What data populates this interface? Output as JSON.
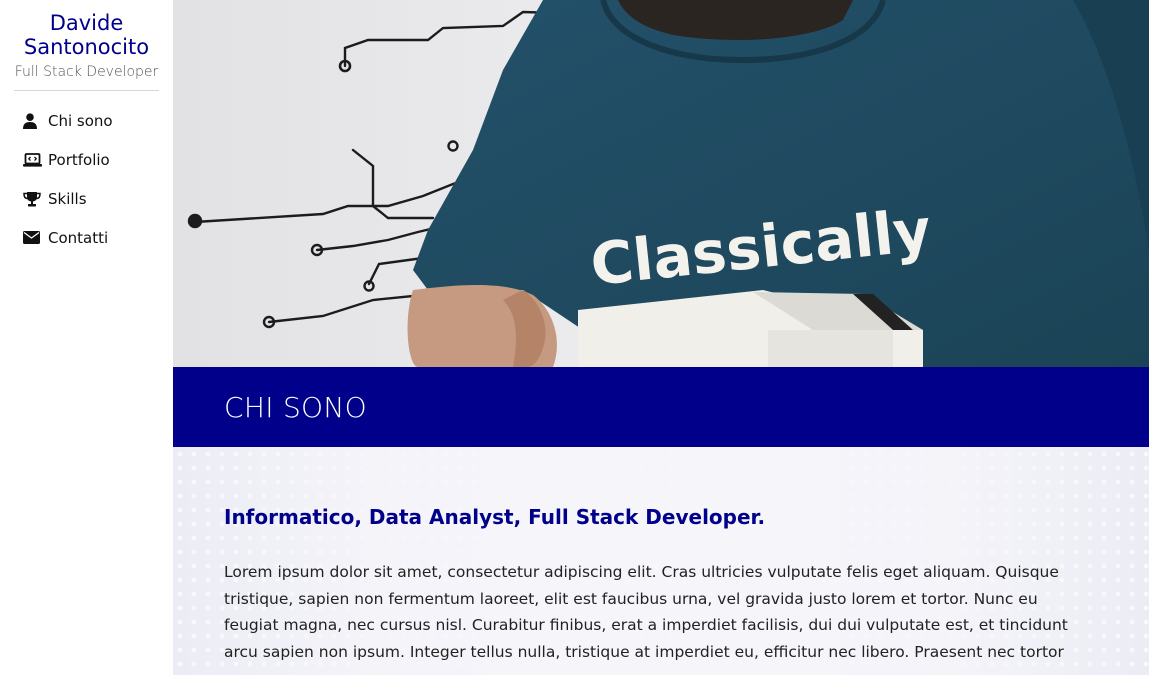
{
  "sidebar": {
    "brand_name": "Davide Santonocito",
    "brand_role": "Full Stack Developer",
    "nav": [
      {
        "label": "Chi sono",
        "icon": "user-icon"
      },
      {
        "label": "Portfolio",
        "icon": "laptop-code-icon"
      },
      {
        "label": "Skills",
        "icon": "trophy-icon"
      },
      {
        "label": "Contatti",
        "icon": "envelope-icon"
      }
    ]
  },
  "hero": {
    "shirt_text": "Classically"
  },
  "section": {
    "title": "CHI SONO",
    "subtitle": "Informatico, Data Analyst, Full Stack Developer.",
    "body": "Lorem ipsum dolor sit amet, consectetur adipiscing elit. Cras ultricies vulputate felis eget aliquam. Quisque tristique, sapien non fermentum laoreet, elit est faucibus urna, vel gravida justo lorem et tortor. Nunc eu feugiat magna, nec cursus nisl. Curabitur finibus, erat a imperdiet facilisis, dui dui vulputate est, et tincidunt arcu sapien non ipsum. Integer tellus nulla, tristique at imperdiet eu, efficitur nec libero. Praesent nec tortor"
  },
  "colors": {
    "accent": "#00008b",
    "shirt": "#1f4a5e",
    "wall": "#e9e9eb"
  }
}
